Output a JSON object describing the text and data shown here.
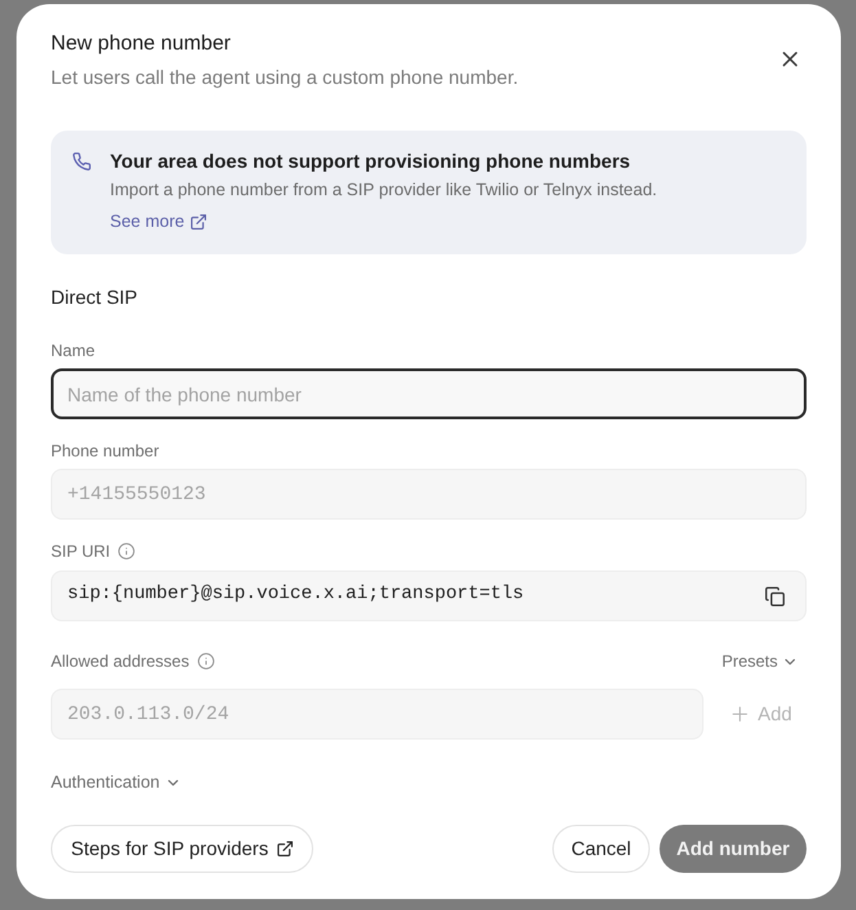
{
  "dialog": {
    "title": "New phone number",
    "subtitle": "Let users call the agent using a custom phone number."
  },
  "alert": {
    "title": "Your area does not support provisioning phone numbers",
    "message": "Import a phone number from a SIP provider like Twilio or Telnyx instead.",
    "link": "See more"
  },
  "section_title": "Direct SIP",
  "fields": [
    {
      "kind": "text",
      "label": "Name",
      "info": false,
      "focused": true,
      "placeholder": "Name of the phone number"
    },
    {
      "kind": "code",
      "label": "Phone number",
      "info": false,
      "focused": false,
      "placeholder": "+14155550123"
    },
    {
      "kind": "copy",
      "label": "SIP URI",
      "info": true,
      "focused": false,
      "value": "sip:{number}@sip.voice.x.ai;transport=tls"
    },
    {
      "kind": "list",
      "label": "Allowed addresses",
      "info": true,
      "focused": false,
      "placeholder": "203.0.113.0/24",
      "menu": "Presets",
      "add_button": {
        "label": "Add",
        "disabled": true
      }
    }
  ],
  "authentication": {
    "label": "Authentication",
    "expanded": false
  },
  "footer": {
    "help_button": "Steps for SIP providers",
    "cancel": "Cancel",
    "submit": {
      "label": "Add number",
      "disabled": true
    }
  }
}
